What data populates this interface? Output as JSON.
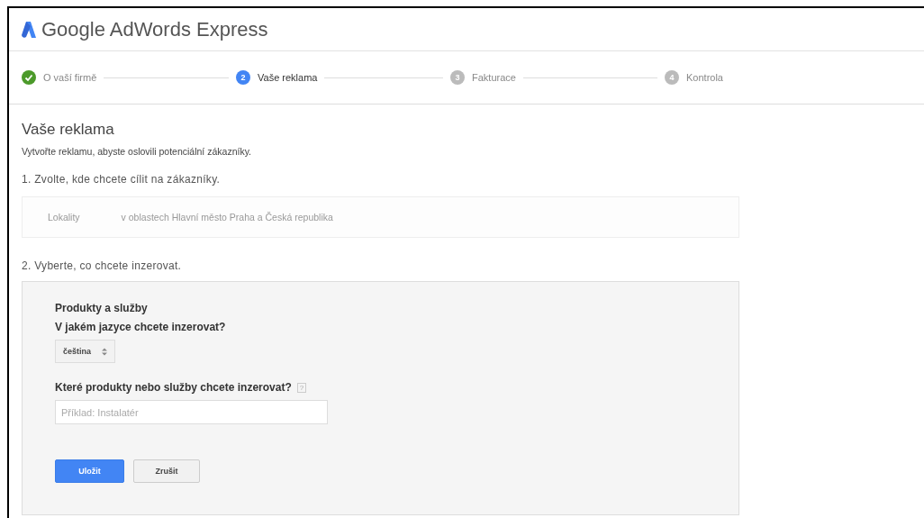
{
  "app": {
    "title": "Google AdWords Express"
  },
  "steps": [
    {
      "label": "O vaší firmě",
      "kind": "done"
    },
    {
      "label": "Vaše reklama",
      "kind": "current",
      "number": "2"
    },
    {
      "label": "Fakturace",
      "kind": "pending",
      "number": "3"
    },
    {
      "label": "Kontrola",
      "kind": "pending",
      "number": "4"
    }
  ],
  "page": {
    "heading": "Vaše reklama",
    "subtitle": "Vytvořte reklamu, abyste oslovili potenciální zákazníky."
  },
  "section1": {
    "title": "1. Zvolte, kde chcete cílit na zákazníky.",
    "label": "Lokality",
    "value": "v oblastech Hlavní město Praha a Česká republika"
  },
  "section2": {
    "title": "2. Vyberte, co chcete inzerovat.",
    "panel_title": "Produkty a služby",
    "language_label": "V jakém jazyce chcete inzerovat?",
    "language": "čeština",
    "products_label": "Které produkty nebo služby chcete inzerovat?",
    "help": "?",
    "products_placeholder": "Příklad: Instalatér",
    "buttons": [
      {
        "label": "Uložit",
        "kind": "primary"
      },
      {
        "label": "Zrušit",
        "kind": "secondary"
      }
    ]
  }
}
